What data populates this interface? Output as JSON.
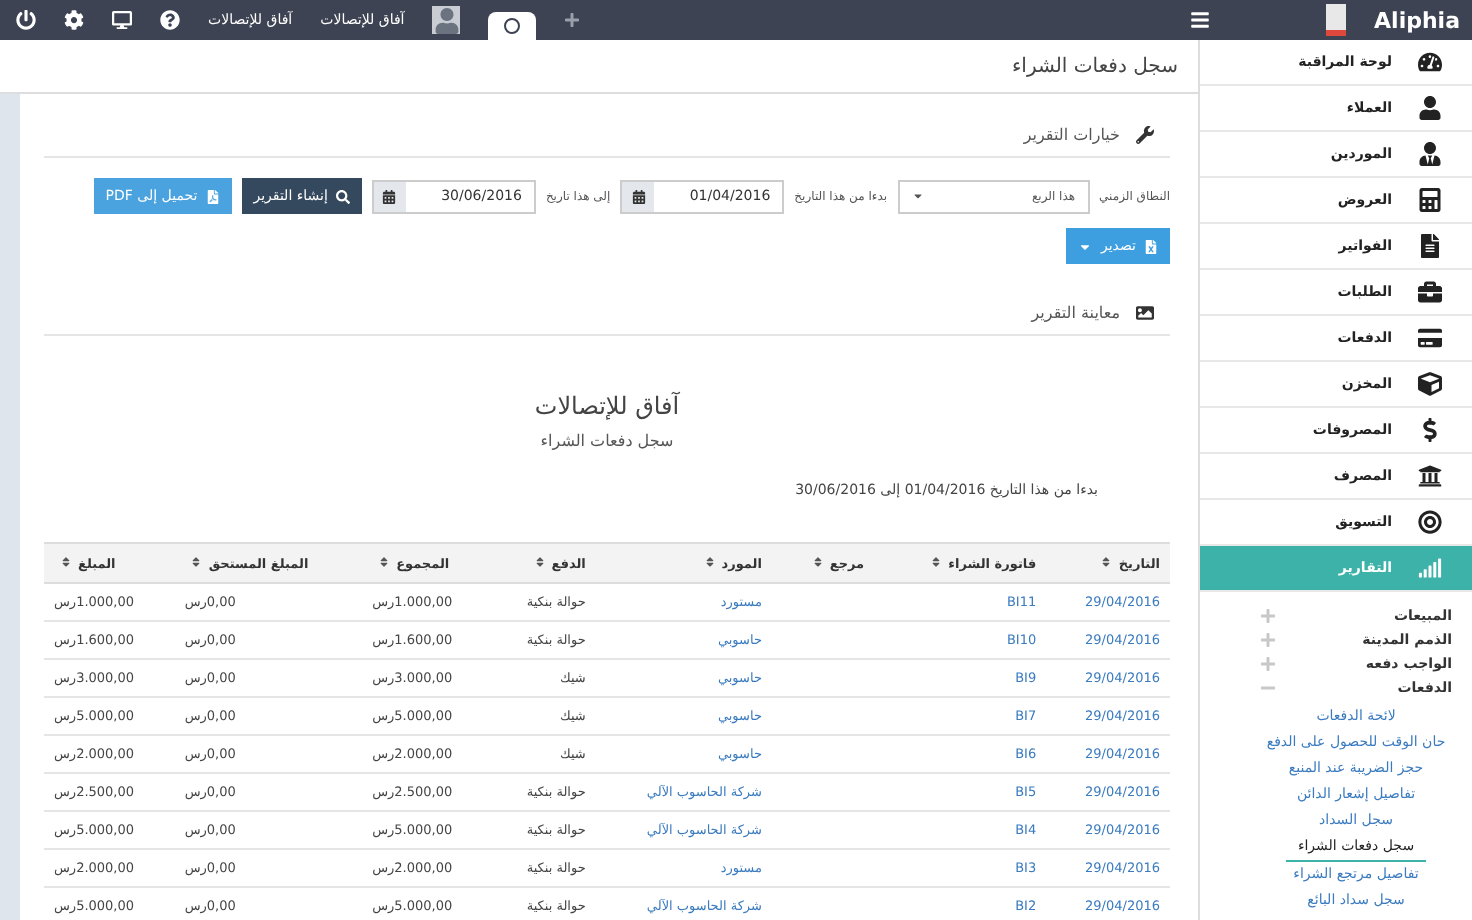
{
  "topbar": {
    "brand": "Aliphia",
    "company_name": "آفاق للإتصالات",
    "user_name": "آفاق للإتصالات"
  },
  "page_title": "سجل دفعات الشراء",
  "options": {
    "heading": "خيارات التقرير",
    "period_label": "النطاق الزمني",
    "period_value": "هذا الربع",
    "from_label": "بدءا من هذا التاريخ",
    "from_value": "01/04/2016",
    "to_label": "إلى هذا تاريخ",
    "to_value": "30/06/2016",
    "generate_button": "إنشاء التقرير",
    "pdf_button": "تحميل إلى PDF",
    "export_button": "تصدير"
  },
  "preview": {
    "heading": "معاينة التقرير",
    "company": "آفاق للإتصالات",
    "report_title": "سجل دفعات الشراء",
    "range": "بدءا من هذا التاريخ 01/04/2016 إلى 30/06/2016"
  },
  "table": {
    "columns": [
      "التاريخ",
      "فاتورة الشراء",
      "مرجع",
      "المورد",
      "الدفع",
      "المجموع",
      "المبلغ المستحق",
      "المبلغ"
    ],
    "rows": [
      [
        "29/04/2016",
        "BI11",
        "",
        "مستورد",
        "حوالة بنكية",
        "1.000,00رس",
        "0,00رس",
        "1.000,00رس"
      ],
      [
        "29/04/2016",
        "BI10",
        "",
        "حاسوبي",
        "حوالة بنكية",
        "1.600,00رس",
        "0,00رس",
        "1.600,00رس"
      ],
      [
        "29/04/2016",
        "BI9",
        "",
        "حاسوبي",
        "شيك",
        "3.000,00رس",
        "0,00رس",
        "3.000,00رس"
      ],
      [
        "29/04/2016",
        "BI7",
        "",
        "حاسوبي",
        "شيك",
        "5.000,00رس",
        "0,00رس",
        "5.000,00رس"
      ],
      [
        "29/04/2016",
        "BI6",
        "",
        "حاسوبي",
        "شيك",
        "2.000,00رس",
        "0,00رس",
        "2.000,00رس"
      ],
      [
        "29/04/2016",
        "BI5",
        "",
        "شركة الحاسوب الآلي",
        "حوالة بنكية",
        "2.500,00رس",
        "0,00رس",
        "2.500,00رس"
      ],
      [
        "29/04/2016",
        "BI4",
        "",
        "شركة الحاسوب الآلي",
        "حوالة بنكية",
        "5.000,00رس",
        "0,00رس",
        "5.000,00رس"
      ],
      [
        "29/04/2016",
        "BI3",
        "",
        "مستورد",
        "حوالة بنكية",
        "2.000,00رس",
        "0,00رس",
        "2.000,00رس"
      ],
      [
        "29/04/2016",
        "BI2",
        "",
        "شركة الحاسوب الآلي",
        "حوالة بنكية",
        "5.000,00رس",
        "0,00رس",
        "5.000,00رس"
      ]
    ]
  },
  "sidebar": {
    "items": [
      {
        "label": "لوحة المراقبة",
        "selected": false
      },
      {
        "label": "العملاء",
        "selected": false
      },
      {
        "label": "الموردين",
        "selected": false
      },
      {
        "label": "العروض",
        "selected": false
      },
      {
        "label": "الفواتير",
        "selected": false
      },
      {
        "label": "الطلبات",
        "selected": false
      },
      {
        "label": "الدفعات",
        "selected": false
      },
      {
        "label": "المخزن",
        "selected": false
      },
      {
        "label": "المصروفات",
        "selected": false
      },
      {
        "label": "المصرف",
        "selected": false
      },
      {
        "label": "التسويق",
        "selected": false
      },
      {
        "label": "التقارير",
        "selected": true
      }
    ],
    "report_groups": [
      {
        "label": "المبيعات",
        "expanded": false
      },
      {
        "label": "الذمم المدينة",
        "expanded": false
      },
      {
        "label": "الواجب دفعه",
        "expanded": false
      },
      {
        "label": "الدفعات",
        "expanded": true,
        "children": [
          {
            "label": "لائحة الدفعات",
            "selected": false
          },
          {
            "label": "حان الوقت للحصول على الدفع",
            "selected": false
          },
          {
            "label": "حجز الضريبة عند المنبع",
            "selected": false
          },
          {
            "label": "تفاصيل إشعار الدائن",
            "selected": false
          },
          {
            "label": "سجل السداد",
            "selected": false
          },
          {
            "label": "سجل دفعات الشراء",
            "selected": true
          },
          {
            "label": "تفاصيل مرتجع الشراء",
            "selected": false
          },
          {
            "label": "سجل سداد البائع",
            "selected": false
          }
        ]
      }
    ]
  }
}
